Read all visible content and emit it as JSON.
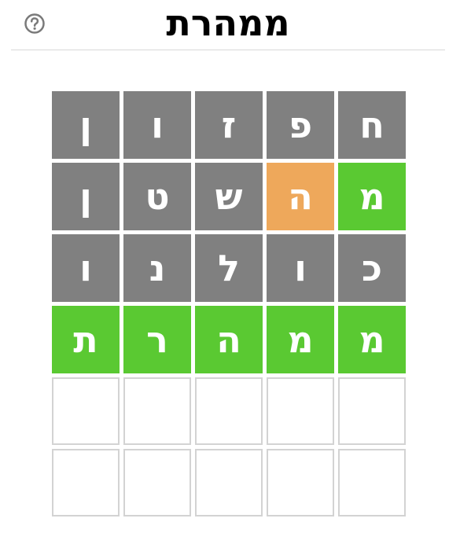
{
  "header": {
    "title": "ממהרת",
    "help_icon": "help-circle-icon"
  },
  "colors": {
    "absent": "#808080",
    "present": "#eea85b",
    "correct": "#5ac932",
    "empty_border": "#d3d3d3"
  },
  "board": {
    "rows": [
      [
        {
          "letter": "ח",
          "state": "absent"
        },
        {
          "letter": "פ",
          "state": "absent"
        },
        {
          "letter": "ז",
          "state": "absent"
        },
        {
          "letter": "ו",
          "state": "absent"
        },
        {
          "letter": "ן",
          "state": "absent"
        }
      ],
      [
        {
          "letter": "מ",
          "state": "correct"
        },
        {
          "letter": "ה",
          "state": "present"
        },
        {
          "letter": "ש",
          "state": "absent"
        },
        {
          "letter": "ט",
          "state": "absent"
        },
        {
          "letter": "ן",
          "state": "absent"
        }
      ],
      [
        {
          "letter": "כ",
          "state": "absent"
        },
        {
          "letter": "ו",
          "state": "absent"
        },
        {
          "letter": "ל",
          "state": "absent"
        },
        {
          "letter": "נ",
          "state": "absent"
        },
        {
          "letter": "ו",
          "state": "absent"
        }
      ],
      [
        {
          "letter": "מ",
          "state": "correct"
        },
        {
          "letter": "מ",
          "state": "correct"
        },
        {
          "letter": "ה",
          "state": "correct"
        },
        {
          "letter": "ר",
          "state": "correct"
        },
        {
          "letter": "ת",
          "state": "correct"
        }
      ],
      [
        {
          "letter": "",
          "state": "empty"
        },
        {
          "letter": "",
          "state": "empty"
        },
        {
          "letter": "",
          "state": "empty"
        },
        {
          "letter": "",
          "state": "empty"
        },
        {
          "letter": "",
          "state": "empty"
        }
      ],
      [
        {
          "letter": "",
          "state": "empty"
        },
        {
          "letter": "",
          "state": "empty"
        },
        {
          "letter": "",
          "state": "empty"
        },
        {
          "letter": "",
          "state": "empty"
        },
        {
          "letter": "",
          "state": "empty"
        }
      ]
    ]
  }
}
